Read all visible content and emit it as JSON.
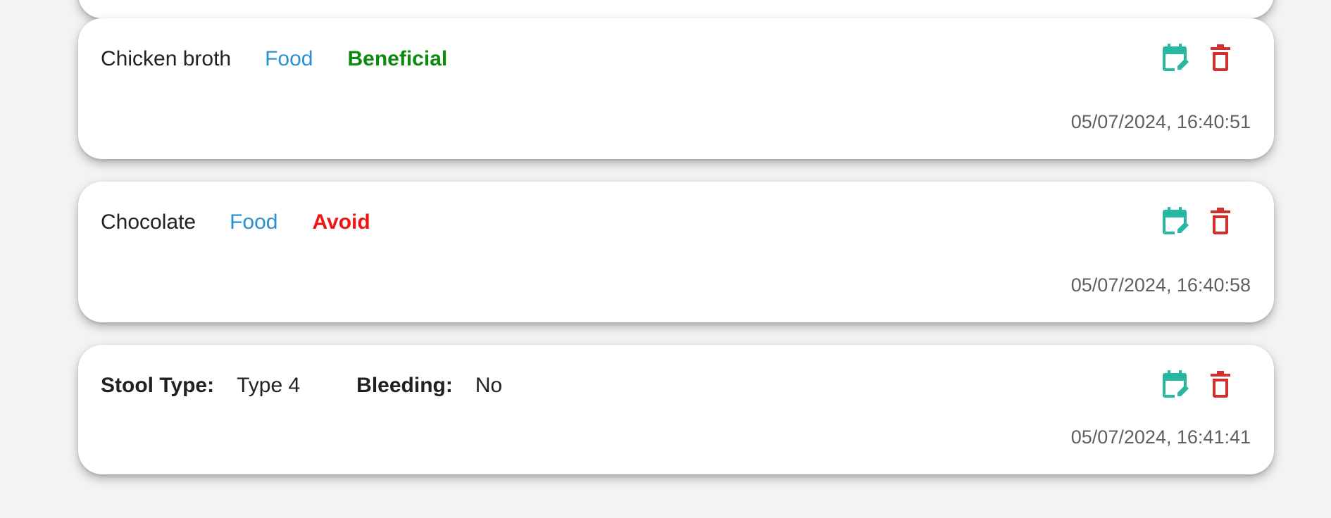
{
  "entries": [
    {
      "name": "Chicken broth",
      "category": "Food",
      "rating": "Beneficial",
      "timestamp": "05/07/2024, 16:40:51"
    },
    {
      "name": "Chocolate",
      "category": "Food",
      "rating": "Avoid",
      "timestamp": "05/07/2024, 16:40:58"
    },
    {
      "stool_type_label": "Stool Type:",
      "stool_type_value": "Type 4",
      "bleeding_label": "Bleeding:",
      "bleeding_value": "No",
      "timestamp": "05/07/2024, 16:41:41"
    }
  ],
  "icons": {
    "edit": "calendar-edit-icon",
    "delete": "trash-icon"
  },
  "colors": {
    "background": "#f1f3f4",
    "card": "#ffffff",
    "category": "#2a8fd4",
    "beneficial": "#0c8a0c",
    "avoid": "#f01515",
    "edit_icon": "#26b8a0",
    "delete_icon": "#d32f2f",
    "timestamp": "#5f5f5f"
  }
}
